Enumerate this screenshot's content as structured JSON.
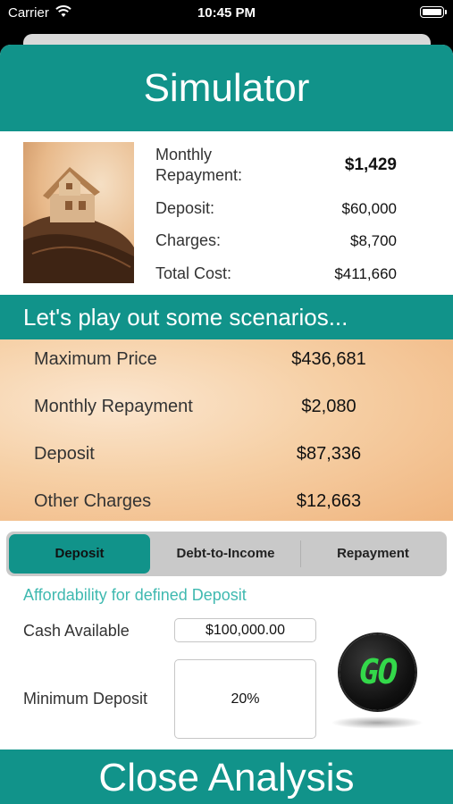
{
  "status_bar": {
    "carrier": "Carrier",
    "time": "10:45 PM"
  },
  "title": "Simulator",
  "summary": {
    "monthly_repayment_label_line1": "Monthly",
    "monthly_repayment_label_line2": "Repayment:",
    "monthly_repayment_value": "$1,429",
    "deposit_label": "Deposit:",
    "deposit_value": "$60,000",
    "charges_label": "Charges:",
    "charges_value": "$8,700",
    "total_cost_label": "Total Cost:",
    "total_cost_value": "$411,660"
  },
  "scenario_header": "Let's play out some scenarios...",
  "scenarios": [
    {
      "label": "Maximum Price",
      "value": "$436,681"
    },
    {
      "label": "Monthly Repayment",
      "value": "$2,080"
    },
    {
      "label": "Deposit",
      "value": "$87,336"
    },
    {
      "label": "Other Charges",
      "value": "$12,663"
    }
  ],
  "tabs": [
    {
      "label": "Deposit",
      "active": true
    },
    {
      "label": "Debt-to-Income",
      "active": false
    },
    {
      "label": "Repayment",
      "active": false
    }
  ],
  "affordability_label": "Affordability for defined Deposit",
  "cash_available": {
    "label": "Cash Available",
    "value": "$100,000.00"
  },
  "minimum_deposit": {
    "label": "Minimum Deposit",
    "value": "20%"
  },
  "go_button": {
    "label": "GO"
  },
  "close_button": {
    "label": "Close Analysis"
  },
  "colors": {
    "accent": "#11938a",
    "accent_light": "#3fb9b0",
    "go_green": "#33d84a"
  }
}
